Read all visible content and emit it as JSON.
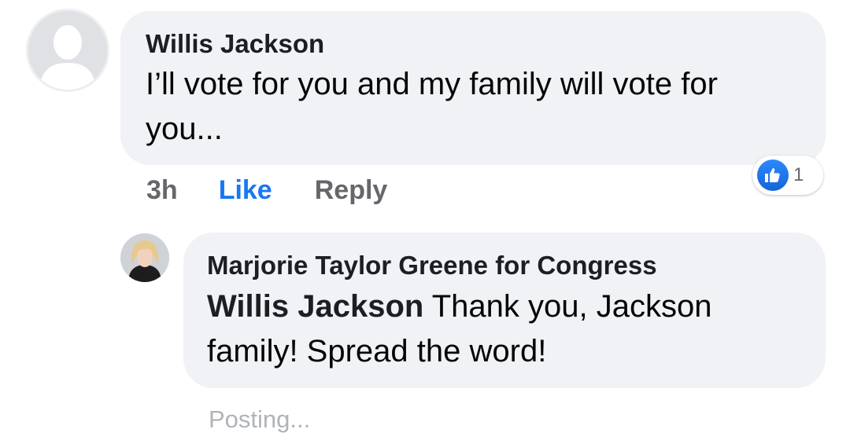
{
  "comment": {
    "author": "Willis Jackson",
    "text": "I’ll vote for you and my family will vote for you...",
    "time": "3h",
    "like_label": "Like",
    "reply_label": "Reply",
    "reaction_count": "1",
    "reaction_icon": "thumbs-up-icon",
    "avatar_icon": "default-profile-silhouette-icon"
  },
  "reply": {
    "author": "Marjorie Taylor Greene for Congress",
    "mention": "Willis Jackson",
    "text": " Thank you, Jackson family! Spread the word!",
    "status": "Posting..."
  },
  "colors": {
    "bubble_bg": "#f0f2f5",
    "like_blue": "#1877f2",
    "secondary_text": "#65676b",
    "posting_text": "#b0b3b8"
  }
}
